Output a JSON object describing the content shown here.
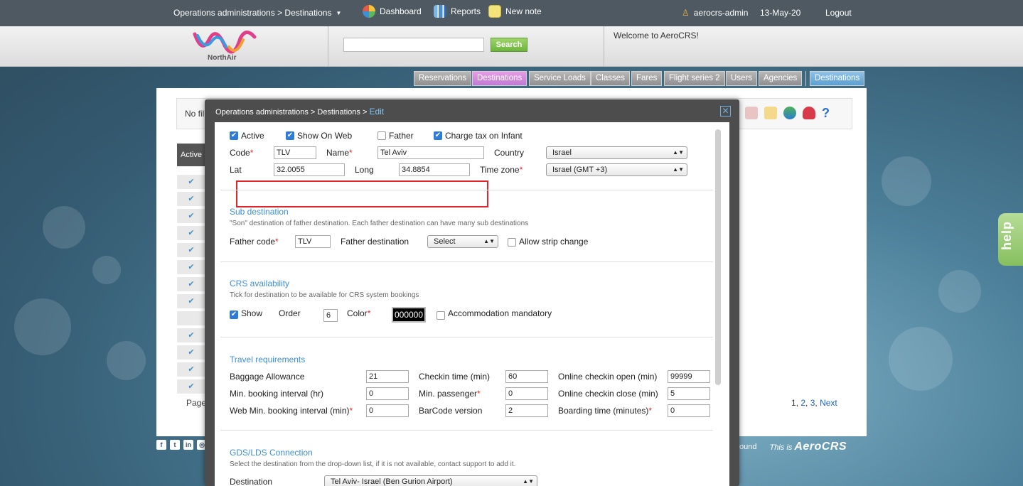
{
  "topbar": {
    "breadcrumb": "Operations administrations > Destinations",
    "dashboard": "Dashboard",
    "reports": "Reports",
    "new_note": "New note",
    "user": "aerocrs-admin",
    "date": "13-May-20",
    "logout": "Logout"
  },
  "header": {
    "logo_text": "NorthAir",
    "search_placeholder": "",
    "search_button": "Search",
    "welcome": "Welcome to AeroCRS!"
  },
  "nav": {
    "tabs": [
      "Reservations",
      "Destinations",
      "Service Loads",
      "Classes",
      "Fares",
      "Flight series 2",
      "Users",
      "Agencies",
      "Destinations"
    ]
  },
  "list": {
    "filter_label": "No fil",
    "active_header": "Active",
    "check": "✔",
    "page_label": "Page",
    "pager": {
      "p1": "1",
      "p2": "2",
      "p3": "3",
      "next": "Next"
    }
  },
  "footer": {
    "around": "ound",
    "this_is": "This is",
    "brand": "AeroCRS"
  },
  "help": "help",
  "modal": {
    "title_path": "Operations administrations > Destinations >",
    "title_action": "Edit",
    "close": "✕",
    "general": {
      "active": "Active",
      "show_on_web": "Show On Web",
      "father": "Father",
      "charge_tax": "Charge tax on Infant",
      "code_label": "Code",
      "code_value": "TLV",
      "name_label": "Name",
      "name_value": "Tel Aviv",
      "country_label": "Country",
      "country_value": "Israel",
      "lat_label": "Lat",
      "lat_value": "32.0055",
      "long_label": "Long",
      "long_value": "34.8854",
      "timezone_label": "Time zone",
      "timezone_value": "Israel (GMT +3)"
    },
    "sub": {
      "title": "Sub destination",
      "desc": "\"Son\" destination of father destination. Each father destination can have many sub destinations",
      "father_code_label": "Father code",
      "father_code_value": "TLV",
      "father_dest_label": "Father destination",
      "father_dest_value": "Select",
      "allow_strip": "Allow strip change"
    },
    "crs": {
      "title": "CRS availability",
      "desc": "Tick for destination to be available for CRS system bookings",
      "show": "Show",
      "order_label": "Order",
      "order_value": "6",
      "color_label": "Color",
      "color_value": "000000",
      "accommodation": "Accommodation mandatory"
    },
    "travel": {
      "title": "Travel requirements",
      "baggage_label": "Baggage Allowance",
      "baggage_value": "21",
      "checkin_label": "Checkin time (min)",
      "checkin_value": "60",
      "online_open_label": "Online checkin open (min)",
      "online_open_value": "99999",
      "min_booking_label": "Min. booking interval (hr)",
      "min_booking_value": "0",
      "min_passenger_label": "Min. passenger",
      "min_passenger_value": "0",
      "online_close_label": "Online checkin close (min)",
      "online_close_value": "5",
      "web_min_label": "Web Min. booking interval (min)",
      "web_min_value": "0",
      "barcode_label": "BarCode version",
      "barcode_value": "2",
      "boarding_label": "Boarding time (minutes)",
      "boarding_value": "0"
    },
    "gds": {
      "title": "GDS/LDS Connection",
      "desc": "Select the destination from the drop-down list, if it is not available, contact support to add it.",
      "destination_label": "Destination",
      "destination_value": "Tel Aviv- Israel (Ben Gurion Airport)"
    },
    "required_mark": "*",
    "check_mark": "✔"
  },
  "colors": {
    "accent_blue": "#3c8fd6",
    "required_red": "#e0262b",
    "highlight_red": "#e0262b",
    "search_green": "#6db43d"
  }
}
